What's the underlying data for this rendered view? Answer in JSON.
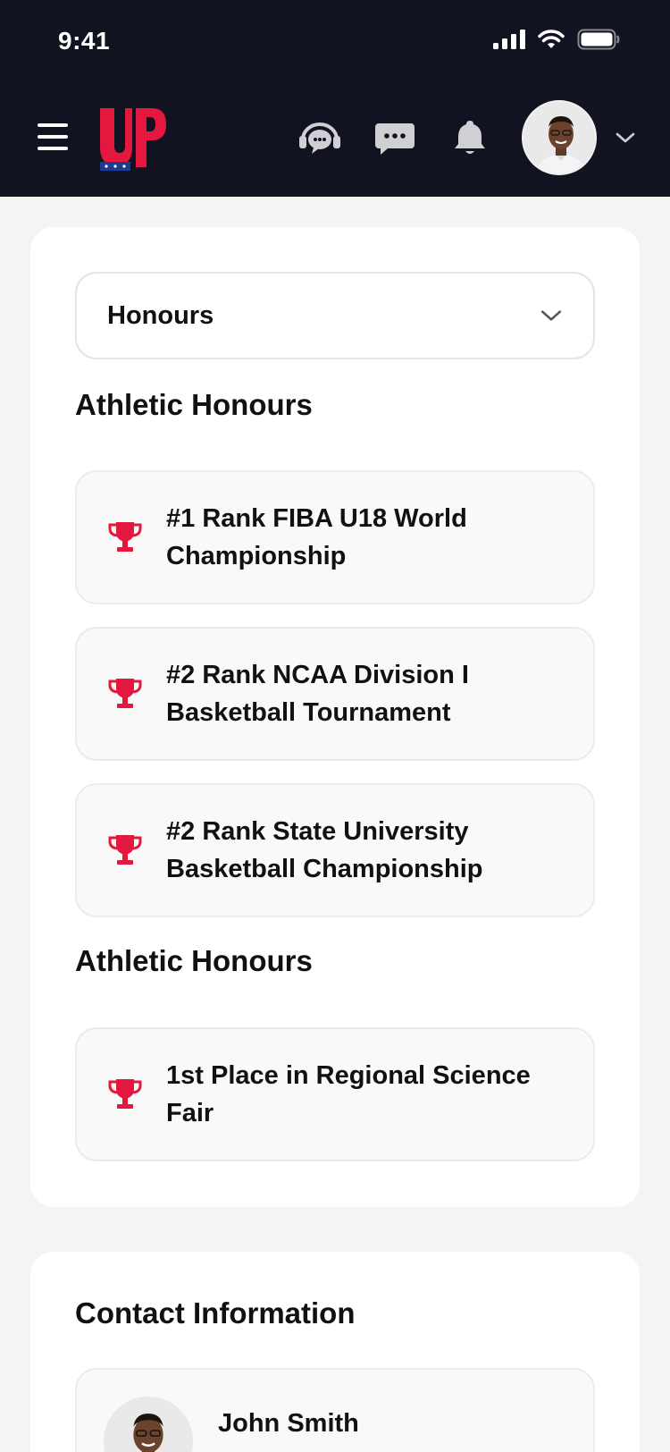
{
  "status_bar": {
    "time": "9:41"
  },
  "header": {
    "logo_text": "UP",
    "icons": [
      "menu-icon",
      "support-chat-icon",
      "messages-icon",
      "bell-icon",
      "chevron-down-icon"
    ]
  },
  "honours": {
    "select_value": "Honours",
    "sections": [
      {
        "title": "Athletic Honours",
        "items": [
          "#1 Rank FIBA U18 World Championship",
          "#2 Rank NCAA Division I Basketball Tournament",
          "#2 Rank State University Basketball Championship"
        ]
      },
      {
        "title": "Athletic Honours",
        "items": [
          "1st Place in Regional Science Fair"
        ]
      }
    ]
  },
  "contact": {
    "title": "Contact Information",
    "name": "John Smith"
  },
  "colors": {
    "header_bg": "#111320",
    "accent_red": "#e4173e",
    "card_bg": "#ffffff",
    "page_bg": "#f4f4f5"
  }
}
